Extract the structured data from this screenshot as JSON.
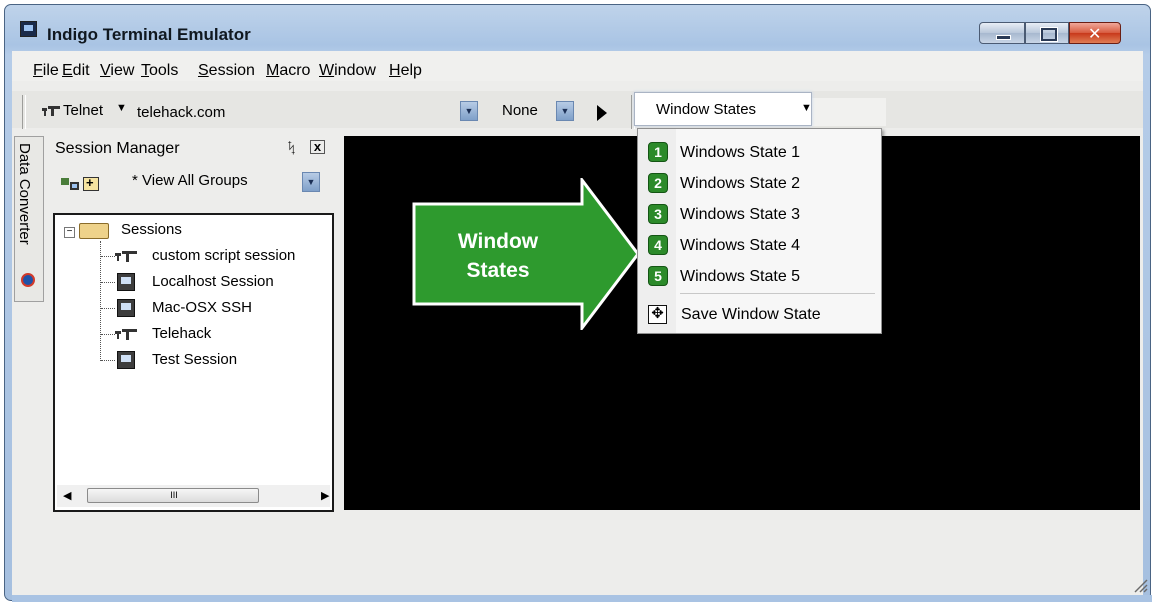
{
  "window": {
    "title": "Indigo Terminal Emulator",
    "minimize": "minimize",
    "maximize": "maximize",
    "close": "close"
  },
  "menubar": {
    "items": [
      "File",
      "Edit",
      "View",
      "Tools",
      "Session",
      "Macro",
      "Window",
      "Help"
    ],
    "underline": [
      "F",
      "E",
      "V",
      "T",
      "S",
      "M",
      "W",
      "H"
    ]
  },
  "toolbar": {
    "protocol": "Telnet",
    "host": "telehack.com",
    "macro": "None",
    "window_states_button": "Window States"
  },
  "dock_tab": {
    "label": "Data Converter"
  },
  "session_manager": {
    "title": "Session Manager",
    "pin_glyph": "ᛪ",
    "close_glyph": "x",
    "filter": "* View All Groups",
    "root": "Sessions",
    "sessions": [
      {
        "label": "custom script session",
        "icon": "network-icon"
      },
      {
        "label": "Localhost Session",
        "icon": "monitor-icon"
      },
      {
        "label": "Mac-OSX SSH",
        "icon": "monitor-icon"
      },
      {
        "label": "Telehack",
        "icon": "network-icon"
      },
      {
        "label": "Test Session",
        "icon": "monitor-icon"
      }
    ],
    "scroll_grip": "III"
  },
  "callout": {
    "line1": "Window",
    "line2": "States",
    "color": "#2e9a2e"
  },
  "window_states_menu": {
    "items": [
      {
        "num": "1",
        "label": "Windows State 1"
      },
      {
        "num": "2",
        "label": "Windows State 2"
      },
      {
        "num": "3",
        "label": "Windows State 3"
      },
      {
        "num": "4",
        "label": "Windows State 4"
      },
      {
        "num": "5",
        "label": "Windows State 5"
      }
    ],
    "save_label": "Save Window State"
  }
}
